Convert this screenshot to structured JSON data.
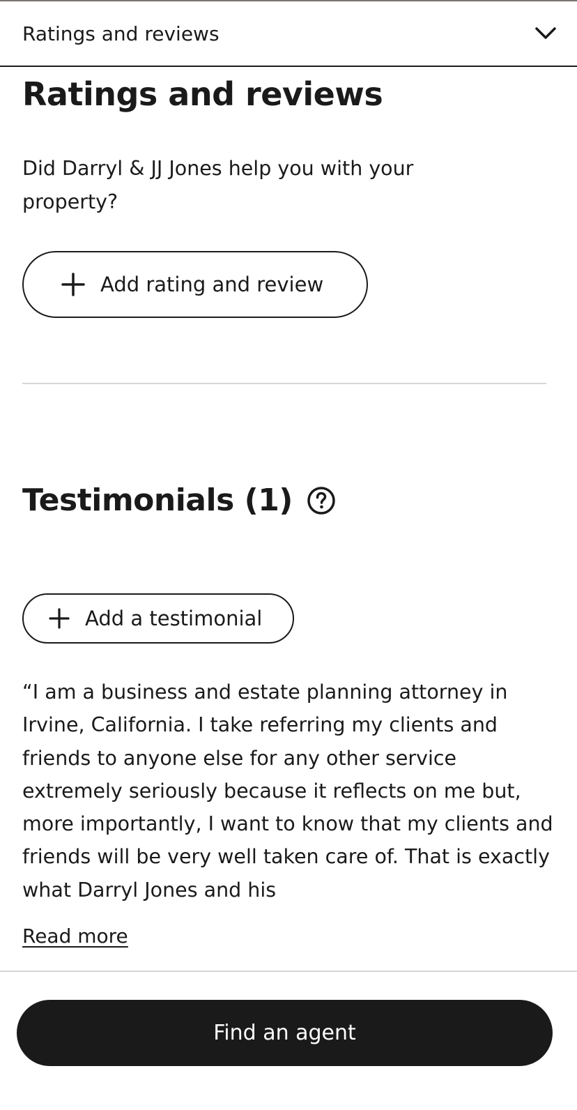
{
  "accordion": {
    "title": "Ratings and reviews",
    "toggle_icon": "chevron-down-icon"
  },
  "ratings": {
    "heading": "Ratings and reviews",
    "prompt": "Did Darryl & JJ Jones help you with your property?",
    "add_button_label": "Add rating and review",
    "add_button_icon": "plus-icon"
  },
  "testimonials": {
    "heading": "Testimonials (1)",
    "help_icon": "help-circle-icon",
    "add_button_label": "Add a testimonial",
    "add_button_icon": "plus-icon",
    "items": [
      {
        "text": "“I am a business and estate planning attorney in Irvine, California. I take referring my clients and friends to anyone else for any other service extremely seriously because it reflects on me but, more importantly, I want to know that my clients and friends will be very well taken care of. That is exactly what Darryl Jones and his",
        "read_more_label": "Read more"
      }
    ]
  },
  "footer": {
    "cta_label": "Find an agent"
  },
  "colors": {
    "text": "#1a1a1a",
    "background": "#ffffff",
    "divider": "#d6d6d6",
    "cta_background": "#1a1a1a",
    "cta_text": "#ffffff"
  }
}
